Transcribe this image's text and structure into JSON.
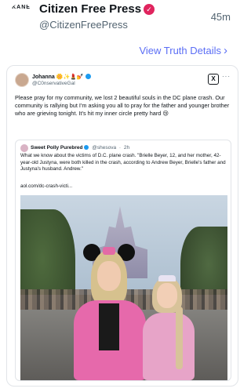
{
  "post": {
    "author_name": "Citizen Free Press",
    "author_handle": "@CitizenFreePress",
    "time": "45m",
    "avatar_text": "KANE",
    "verified_mark": "✓"
  },
  "truth_details": {
    "label": "View Truth Details",
    "chevron": "›"
  },
  "embedded_post": {
    "author_name": "Johanna",
    "author_emojis": "🌼✨💄💅",
    "author_handle": "@C0nservativeGal",
    "x_logo": "X",
    "more": "···",
    "text": "Please pray for my community, we lost 2 beautiful souls in the DC plane crash. Our community is rallying but I'm asking you all to pray for the father and younger brother who are grieving tonight. It's hit my inner circle pretty hard 😢"
  },
  "quoted_post": {
    "author_name": "Sweet Polly Purebred",
    "author_handle": "@shesova",
    "time": "2h",
    "text": "What we know about the victims of D.C. plane crash. \"Brielle Beyer, 12, and her mother, 42-year-old Justyna, were both killed in the crash, according to Andrew Beyer, Brielle's father and Justyna's husband. Andrew.\"",
    "link": "aol.com/dc-crash-victi..."
  },
  "icons": {
    "verified": "verified-badge-icon",
    "x": "x-logo-icon",
    "more": "more-options-icon",
    "chevron": "chevron-right-icon"
  },
  "colors": {
    "accent": "#5b6ef5",
    "verified_pink": "#e0245e",
    "verified_blue": "#1d9bf0",
    "muted": "#536471"
  }
}
